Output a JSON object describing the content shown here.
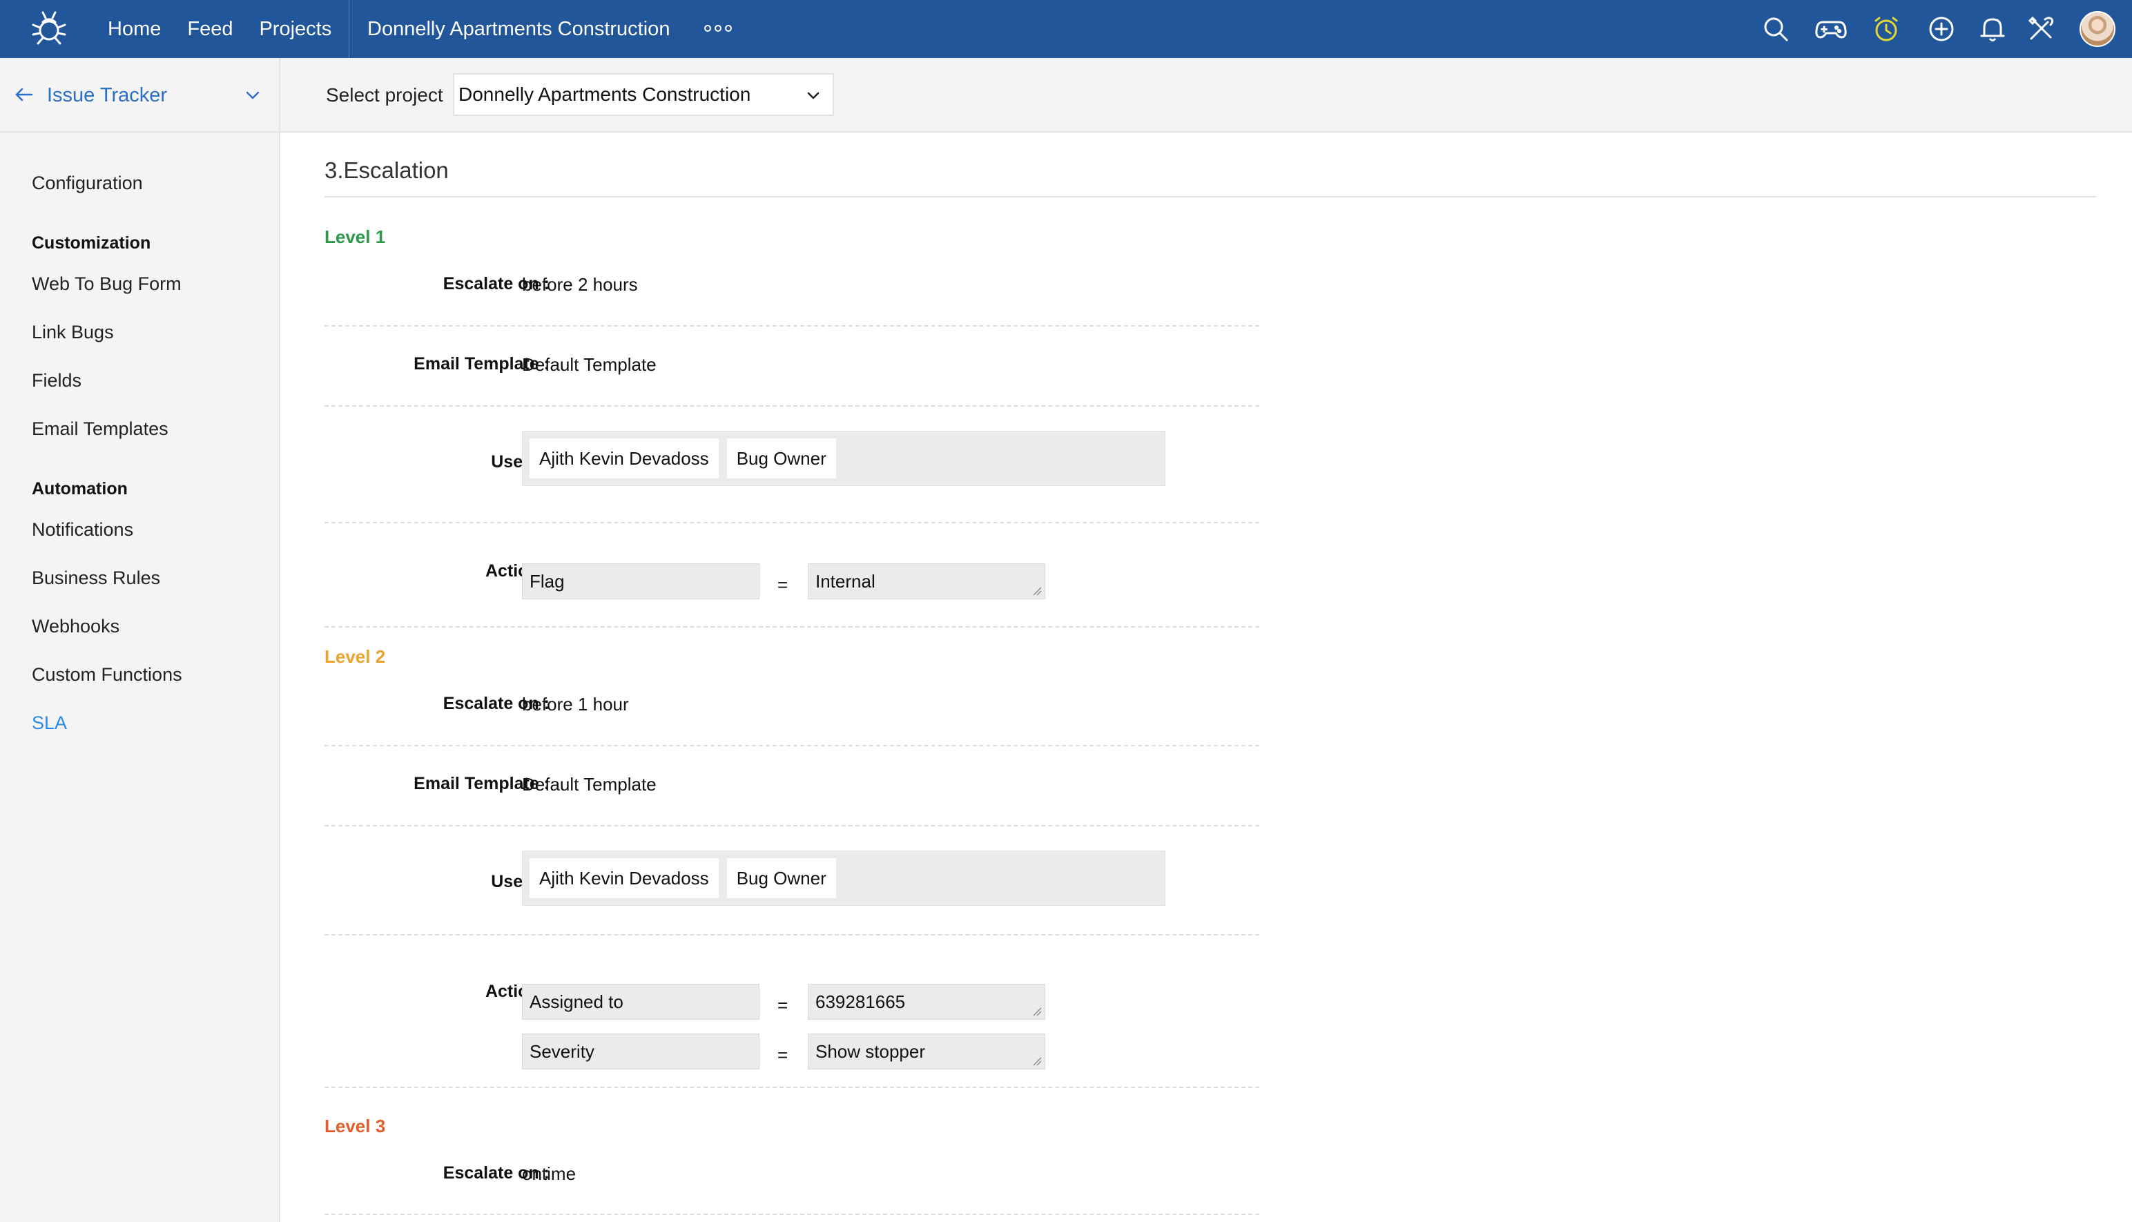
{
  "app": {
    "nav": [
      "Home",
      "Feed",
      "Projects"
    ],
    "project_title": "Donnelly Apartments Construction",
    "icons": [
      "search-icon",
      "gamepad-icon",
      "timer-icon",
      "add-icon",
      "bell-icon",
      "tools-icon"
    ],
    "accent_color": "#21569a"
  },
  "sidebar": {
    "title": "Issue Tracker",
    "config": "Configuration",
    "groups": {
      "customization": "Customization",
      "automation": "Automation"
    },
    "customization_items": [
      "Web To Bug Form",
      "Link Bugs",
      "Fields",
      "Email Templates"
    ],
    "automation_items": [
      "Notifications",
      "Business Rules",
      "Webhooks",
      "Custom Functions",
      "SLA"
    ],
    "active_item": "SLA"
  },
  "project_bar": {
    "label": "Select project",
    "selected": "Donnelly Apartments Construction"
  },
  "section": {
    "title": "3.Escalation",
    "labels": {
      "escalate_on": "Escalate on :",
      "email_template": "Email Template :",
      "users": "Users :",
      "action": "Action :",
      "equals": "="
    },
    "levels": [
      {
        "name": "Level 1",
        "color": "#2a9a4a",
        "escalate_on": "before 2 hours",
        "email_template": "Default Template",
        "users": [
          "Ajith Kevin Devadoss",
          "Bug Owner"
        ],
        "actions": [
          {
            "field": "Flag",
            "value": "Internal"
          }
        ]
      },
      {
        "name": "Level 2",
        "color": "#e8a431",
        "escalate_on": "before 1 hour",
        "email_template": "Default Template",
        "users": [
          "Ajith Kevin Devadoss",
          "Bug Owner"
        ],
        "actions": [
          {
            "field": "Assigned to",
            "value": "639281665"
          },
          {
            "field": "Severity",
            "value": "Show stopper"
          }
        ]
      },
      {
        "name": "Level 3",
        "color": "#e0602a",
        "escalate_on": "ontime"
      }
    ]
  }
}
